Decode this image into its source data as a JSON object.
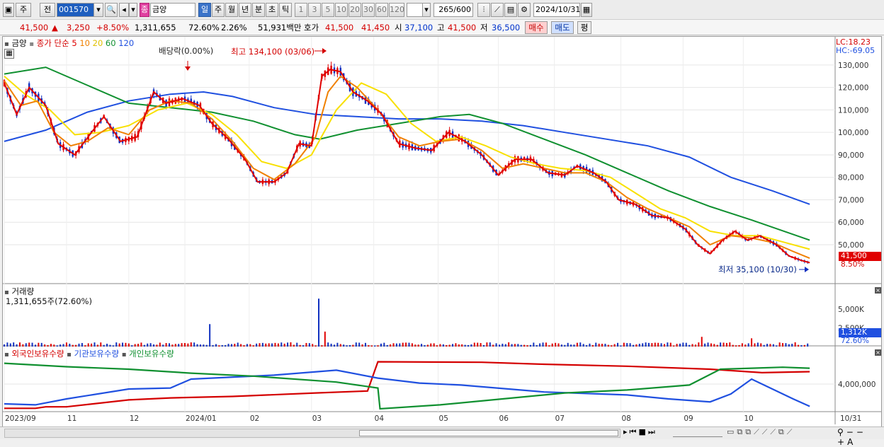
{
  "toolbar": {
    "mode_main": "주",
    "mode_prev": "전",
    "code": "001570",
    "stock_badge": "종",
    "stock_name": "금양",
    "periods": [
      "일",
      "주",
      "월",
      "년",
      "분",
      "초",
      "틱"
    ],
    "active_period": "일",
    "intervals": [
      "1",
      "3",
      "5",
      "10",
      "20",
      "30",
      "60",
      "120"
    ],
    "count": "265",
    "count_total": "/600",
    "date": "2024/10/31"
  },
  "quote": {
    "price": "41,500",
    "change": "3,250",
    "change_pct": "+8.50%",
    "volume": "1,311,655",
    "vol_ratio": "72.60%",
    "turnover": "2.26%",
    "amount": "51,931백만",
    "ask_label": "호가",
    "ask": "41,500",
    "bid": "41,450",
    "open_label": "시",
    "open": "37,100",
    "high_label": "고",
    "high": "41,500",
    "low_label": "저",
    "low": "36,500",
    "buy_label": "매수",
    "sell_label": "매도",
    "eval_label": "평"
  },
  "price_panel": {
    "name": "금양",
    "legend_prefix": "종가 단순",
    "ma_labels": [
      {
        "label": "5",
        "color": "#e00000"
      },
      {
        "label": "10",
        "color": "#f08000"
      },
      {
        "label": "20",
        "color": "#f0d000"
      },
      {
        "label": "60",
        "color": "#109030"
      },
      {
        "label": "120",
        "color": "#2050e0"
      }
    ],
    "dividend_note": "배당락(0.00%)",
    "high_note": "최고 134,100 (03/06)",
    "low_note": "최저 35,100 (10/30)",
    "lc": "LC:18.23",
    "hc": "HC:-69.05",
    "last_price_tag": "41,500",
    "last_pct_tag": "8.50%"
  },
  "volume_panel": {
    "title": "거래량",
    "value": "1,311,655주(72.60%)",
    "last_tag": "1,312K",
    "last_pct": "72.60%"
  },
  "holding_panel": {
    "legends": [
      {
        "label": "외국인보유수량",
        "color": "#d40000"
      },
      {
        "label": "기관보유수량",
        "color": "#2050e0"
      },
      {
        "label": "개인보유수량",
        "color": "#109030"
      }
    ]
  },
  "x_axis": [
    "2023/09",
    "11",
    "12",
    "2024/01",
    "02",
    "03",
    "04",
    "05",
    "06",
    "07",
    "08",
    "09",
    "10",
    "10/31"
  ],
  "chart_data": [
    {
      "type": "line",
      "title": "금양 일봉",
      "y_axis_ticks": [
        50000,
        60000,
        70000,
        80000,
        90000,
        100000,
        110000,
        120000,
        130000
      ],
      "y_tick_labels": [
        "50,000",
        "60,000",
        "70,000",
        "80,000",
        "90,000",
        "100,000",
        "110,000",
        "120,000",
        "130,000"
      ],
      "x_labels": [
        "2023/09",
        "11",
        "12",
        "2024/01",
        "02",
        "03",
        "04",
        "05",
        "06",
        "07",
        "08",
        "09",
        "10"
      ],
      "series": [
        {
          "name": "5",
          "points": [
            [
              0,
              122000
            ],
            [
              6,
              108000
            ],
            [
              12,
              120000
            ],
            [
              20,
              112000
            ],
            [
              26,
              95000
            ],
            [
              34,
              90000
            ],
            [
              42,
              100000
            ],
            [
              48,
              107000
            ],
            [
              56,
              96000
            ],
            [
              64,
              98000
            ],
            [
              72,
              118000
            ],
            [
              78,
              113000
            ],
            [
              86,
              115000
            ],
            [
              94,
              112000
            ],
            [
              100,
              104000
            ],
            [
              108,
              97000
            ],
            [
              116,
              88000
            ],
            [
              122,
              78000
            ],
            [
              130,
              78000
            ],
            [
              136,
              82000
            ],
            [
              142,
              95000
            ],
            [
              148,
              94000
            ],
            [
              153,
              125000
            ],
            [
              157,
              128000
            ],
            [
              162,
              127000
            ],
            [
              168,
              118000
            ],
            [
              175,
              114000
            ],
            [
              182,
              108000
            ],
            [
              190,
              95000
            ],
            [
              198,
              93000
            ],
            [
              206,
              92000
            ],
            [
              214,
              100000
            ],
            [
              222,
              96000
            ],
            [
              230,
              90000
            ],
            [
              238,
              81000
            ],
            [
              246,
              88000
            ],
            [
              254,
              88000
            ],
            [
              262,
              82000
            ],
            [
              270,
              81000
            ],
            [
              276,
              85000
            ],
            [
              284,
              82000
            ],
            [
              290,
              78000
            ],
            [
              296,
              70000
            ],
            [
              304,
              68000
            ],
            [
              312,
              63000
            ],
            [
              320,
              62000
            ],
            [
              328,
              57000
            ],
            [
              334,
              50000
            ],
            [
              340,
              46000
            ],
            [
              346,
              52000
            ],
            [
              352,
              56000
            ],
            [
              358,
              52000
            ],
            [
              364,
              54000
            ],
            [
              372,
              50000
            ],
            [
              378,
              45000
            ],
            [
              384,
              43000
            ],
            [
              388,
              42000
            ]
          ]
        },
        {
          "name": "10",
          "points": [
            [
              0,
              123000
            ],
            [
              8,
              112000
            ],
            [
              16,
              114000
            ],
            [
              24,
              100000
            ],
            [
              32,
              94000
            ],
            [
              40,
              96000
            ],
            [
              50,
              102000
            ],
            [
              60,
              99000
            ],
            [
              70,
              110000
            ],
            [
              80,
              114000
            ],
            [
              90,
              113000
            ],
            [
              100,
              106000
            ],
            [
              110,
              96000
            ],
            [
              120,
              84000
            ],
            [
              130,
              79000
            ],
            [
              140,
              86000
            ],
            [
              150,
              98000
            ],
            [
              156,
              118000
            ],
            [
              162,
              125000
            ],
            [
              170,
              120000
            ],
            [
              180,
              110000
            ],
            [
              190,
              98000
            ],
            [
              200,
              94000
            ],
            [
              210,
              96000
            ],
            [
              220,
              97000
            ],
            [
              230,
              92000
            ],
            [
              240,
              84000
            ],
            [
              250,
              86000
            ],
            [
              260,
              84000
            ],
            [
              270,
              82000
            ],
            [
              280,
              82000
            ],
            [
              290,
              78000
            ],
            [
              300,
              71000
            ],
            [
              310,
              66000
            ],
            [
              320,
              62000
            ],
            [
              330,
              58000
            ],
            [
              340,
              50000
            ],
            [
              350,
              54000
            ],
            [
              360,
              53000
            ],
            [
              370,
              51000
            ],
            [
              380,
              47000
            ],
            [
              388,
              44000
            ]
          ]
        },
        {
          "name": "20",
          "points": [
            [
              0,
              125000
            ],
            [
              10,
              117000
            ],
            [
              22,
              110000
            ],
            [
              34,
              99000
            ],
            [
              46,
              100000
            ],
            [
              60,
              103000
            ],
            [
              74,
              110000
            ],
            [
              88,
              113000
            ],
            [
              100,
              108000
            ],
            [
              112,
              99000
            ],
            [
              124,
              87000
            ],
            [
              136,
              84000
            ],
            [
              148,
              90000
            ],
            [
              160,
              110000
            ],
            [
              172,
              122000
            ],
            [
              184,
              117000
            ],
            [
              196,
              104000
            ],
            [
              208,
              96000
            ],
            [
              220,
              98000
            ],
            [
              232,
              94000
            ],
            [
              244,
              89000
            ],
            [
              256,
              86000
            ],
            [
              268,
              84000
            ],
            [
              280,
              83000
            ],
            [
              292,
              80000
            ],
            [
              304,
              73000
            ],
            [
              316,
              66000
            ],
            [
              328,
              62000
            ],
            [
              340,
              56000
            ],
            [
              352,
              54000
            ],
            [
              364,
              54000
            ],
            [
              376,
              51000
            ],
            [
              388,
              48000
            ]
          ]
        },
        {
          "name": "60",
          "points": [
            [
              0,
              126000
            ],
            [
              20,
              129000
            ],
            [
              40,
              121000
            ],
            [
              60,
              113000
            ],
            [
              80,
              111000
            ],
            [
              100,
              109000
            ],
            [
              120,
              105000
            ],
            [
              140,
              99000
            ],
            [
              152,
              97000
            ],
            [
              170,
              101000
            ],
            [
              190,
              104000
            ],
            [
              210,
              107000
            ],
            [
              224,
              108000
            ],
            [
              240,
              104000
            ],
            [
              260,
              97000
            ],
            [
              280,
              90000
            ],
            [
              300,
              82000
            ],
            [
              320,
              74000
            ],
            [
              340,
              67000
            ],
            [
              360,
              61000
            ],
            [
              388,
              52000
            ]
          ]
        },
        {
          "name": "120",
          "points": [
            [
              0,
              96000
            ],
            [
              20,
              101000
            ],
            [
              40,
              109000
            ],
            [
              60,
              114000
            ],
            [
              80,
              117000
            ],
            [
              96,
              118000
            ],
            [
              110,
              116000
            ],
            [
              130,
              111000
            ],
            [
              150,
              108000
            ],
            [
              170,
              107000
            ],
            [
              190,
              106000
            ],
            [
              210,
              106000
            ],
            [
              230,
              105000
            ],
            [
              250,
              103000
            ],
            [
              270,
              100000
            ],
            [
              290,
              97000
            ],
            [
              310,
              94000
            ],
            [
              330,
              89000
            ],
            [
              350,
              80000
            ],
            [
              370,
              74000
            ],
            [
              388,
              68000
            ]
          ]
        }
      ]
    },
    {
      "type": "bar",
      "title": "거래량",
      "y_tick_labels": [
        "2,500K",
        "5,000K"
      ],
      "y_axis_ticks": [
        2500,
        5000
      ],
      "unit": "K",
      "spikes": [
        [
          19,
          2300
        ],
        [
          61,
          1500
        ],
        [
          99,
          3000
        ],
        [
          152,
          6400
        ],
        [
          155,
          2000
        ],
        [
          181,
          2800
        ],
        [
          336,
          1300
        ],
        [
          343,
          2300
        ],
        [
          360,
          1100
        ],
        [
          388,
          1312
        ]
      ]
    },
    {
      "type": "line",
      "title": "보유수량",
      "y_tick_labels": [
        "4,000,000"
      ],
      "series": [
        {
          "name": "외국인보유수량",
          "points": [
            [
              0,
              1
            ],
            [
              15,
              1
            ],
            [
              20,
              4
            ],
            [
              30,
              4
            ],
            [
              60,
              18
            ],
            [
              80,
              22
            ],
            [
              110,
              25
            ],
            [
              150,
              32
            ],
            [
              175,
              36
            ],
            [
              180,
              95
            ],
            [
              230,
              94
            ],
            [
              260,
              90
            ],
            [
              300,
              86
            ],
            [
              340,
              80
            ],
            [
              365,
              73
            ],
            [
              388,
              75
            ]
          ]
        },
        {
          "name": "기관보유수량",
          "points": [
            [
              0,
              10
            ],
            [
              15,
              8
            ],
            [
              30,
              20
            ],
            [
              60,
              40
            ],
            [
              80,
              42
            ],
            [
              90,
              60
            ],
            [
              130,
              68
            ],
            [
              160,
              78
            ],
            [
              180,
              62
            ],
            [
              200,
              52
            ],
            [
              220,
              48
            ],
            [
              260,
              34
            ],
            [
              300,
              28
            ],
            [
              320,
              20
            ],
            [
              340,
              14
            ],
            [
              350,
              30
            ],
            [
              360,
              60
            ],
            [
              370,
              40
            ],
            [
              380,
              20
            ],
            [
              388,
              5
            ]
          ]
        },
        {
          "name": "개인보유수량",
          "points": [
            [
              0,
              92
            ],
            [
              30,
              85
            ],
            [
              60,
              80
            ],
            [
              90,
              72
            ],
            [
              120,
              66
            ],
            [
              160,
              54
            ],
            [
              180,
              42
            ],
            [
              181,
              0
            ],
            [
              210,
              8
            ],
            [
              240,
              20
            ],
            [
              270,
              32
            ],
            [
              300,
              38
            ],
            [
              330,
              48
            ],
            [
              345,
              80
            ],
            [
              360,
              82
            ],
            [
              375,
              84
            ],
            [
              388,
              82
            ]
          ]
        }
      ]
    }
  ]
}
